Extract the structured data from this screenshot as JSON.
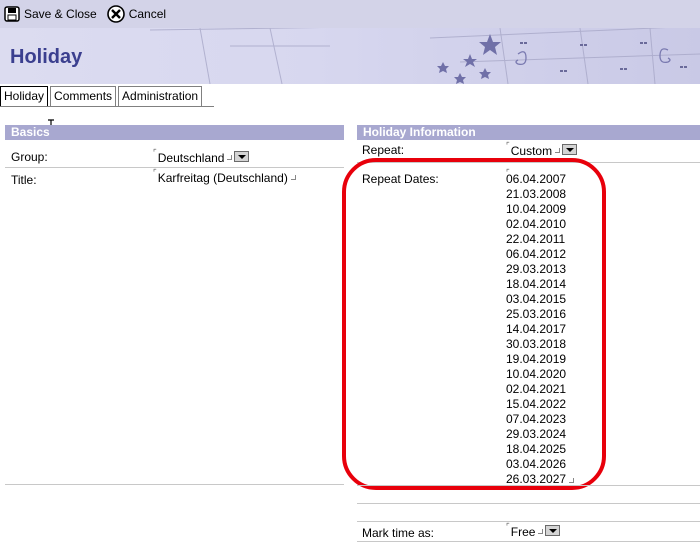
{
  "toolbar": {
    "save_close_label": "Save & Close",
    "cancel_label": "Cancel"
  },
  "banner": {
    "title": "Holiday"
  },
  "tabs": [
    {
      "label": "Holiday",
      "active": true
    },
    {
      "label": "Comments",
      "active": false
    },
    {
      "label": "Administration",
      "active": false
    }
  ],
  "basics": {
    "header": "Basics",
    "group_label": "Group:",
    "group_value": "Deutschland",
    "title_label": "Title:",
    "title_value": "Karfreitag (Deutschland)"
  },
  "holiday_info": {
    "header": "Holiday Information",
    "repeat_label": "Repeat:",
    "repeat_value": "Custom",
    "repeat_dates_label": "Repeat Dates:",
    "repeat_dates": [
      "06.04.2007",
      "21.03.2008",
      "10.04.2009",
      "02.04.2010",
      "22.04.2011",
      "06.04.2012",
      "29.03.2013",
      "18.04.2014",
      "03.04.2015",
      "25.03.2016",
      "14.04.2017",
      "30.03.2018",
      "19.04.2019",
      "10.04.2020",
      "02.04.2021",
      "15.04.2022",
      "07.04.2023",
      "29.03.2024",
      "18.04.2025",
      "03.04.2026",
      "26.03.2027"
    ],
    "mark_time_label": "Mark time as:",
    "mark_time_value": "Free"
  },
  "colors": {
    "toolbar_bg": "#d3d3e8",
    "section_header": "#a8a8d0",
    "title": "#3b3f8f",
    "highlight": "#e8000b"
  }
}
